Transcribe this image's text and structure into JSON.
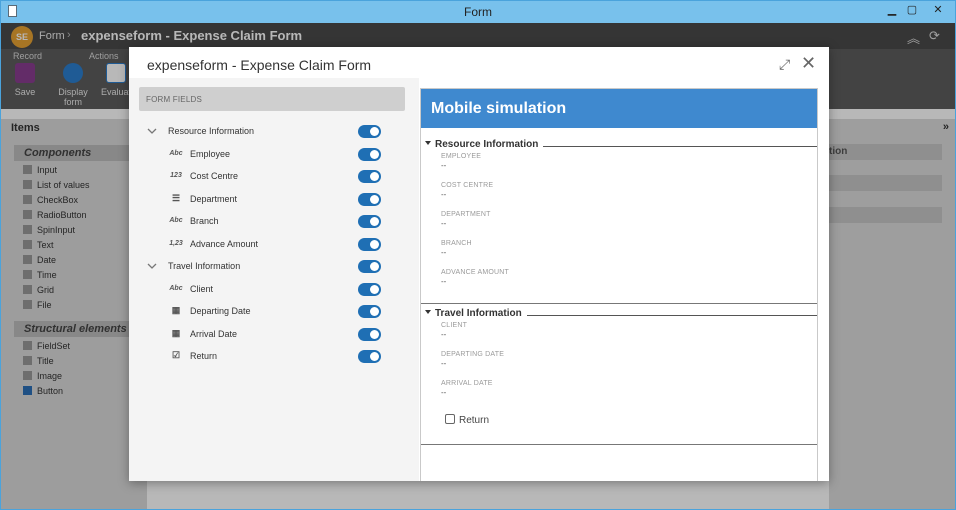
{
  "window": {
    "title": "Form"
  },
  "app": {
    "breadcrumb_root": "Form",
    "breadcrumb_current": "expenseform - Expense Claim Form"
  },
  "ribbon": {
    "group_record": "Record",
    "group_actions": "Actions",
    "save_label": "Save",
    "display_label": "Display form",
    "evaluate_label": "Evaluat"
  },
  "left_panel": {
    "title": "Items",
    "components_title": "Components",
    "components": [
      "Input",
      "List of values",
      "CheckBox",
      "RadioButton",
      "SpinInput",
      "Text",
      "Date",
      "Time",
      "Grid",
      "File"
    ],
    "structural_title": "Structural elements",
    "structural": [
      "FieldSet",
      "Title",
      "Image",
      "Button"
    ]
  },
  "right_panel": {
    "partial_text": "tion"
  },
  "modal": {
    "title": "expenseform - Expense Claim Form",
    "form_fields_header": "FORM FIELDS",
    "fields": [
      {
        "label": "Resource Information",
        "type": "group",
        "icon": "chevron-down-icon",
        "enabled": true
      },
      {
        "label": "Employee",
        "type": "child",
        "icon": "text-icon",
        "icon_text": "Abc",
        "enabled": true
      },
      {
        "label": "Cost Centre",
        "type": "child",
        "icon": "number-icon",
        "icon_text": "123",
        "enabled": true
      },
      {
        "label": "Department",
        "type": "child",
        "icon": "list-icon",
        "icon_text": "",
        "enabled": true
      },
      {
        "label": "Branch",
        "type": "child",
        "icon": "text-icon",
        "icon_text": "Abc",
        "enabled": true
      },
      {
        "label": "Advance Amount",
        "type": "child",
        "icon": "decimal-icon",
        "icon_text": "1,23",
        "enabled": true
      },
      {
        "label": "Travel Information",
        "type": "group",
        "icon": "chevron-down-icon",
        "enabled": true
      },
      {
        "label": "Client",
        "type": "child",
        "icon": "text-icon",
        "icon_text": "Abc",
        "enabled": true
      },
      {
        "label": "Departing Date",
        "type": "child",
        "icon": "calendar-icon",
        "icon_text": "",
        "enabled": true
      },
      {
        "label": "Arrival Date",
        "type": "child",
        "icon": "calendar-icon",
        "icon_text": "",
        "enabled": true
      },
      {
        "label": "Return",
        "type": "child",
        "icon": "checkbox-icon",
        "icon_text": "",
        "enabled": true
      }
    ],
    "mobile": {
      "title": "Mobile simulation",
      "sections": [
        {
          "title": "Resource Information",
          "fields": [
            {
              "label": "EMPLOYEE",
              "value": "--"
            },
            {
              "label": "COST CENTRE",
              "value": "--"
            },
            {
              "label": "DEPARTMENT",
              "value": "--"
            },
            {
              "label": "BRANCH",
              "value": "--"
            },
            {
              "label": "ADVANCE AMOUNT",
              "value": "--"
            }
          ]
        },
        {
          "title": "Travel Information",
          "fields": [
            {
              "label": "CLIENT",
              "value": "--"
            },
            {
              "label": "DEPARTING DATE",
              "value": "--"
            },
            {
              "label": "ARRIVAL DATE",
              "value": "--"
            }
          ],
          "checkbox": {
            "label": "Return",
            "checked": false
          }
        }
      ]
    }
  },
  "colors": {
    "toggle_on": "#1f6fb4",
    "mobile_header": "#3f89cf",
    "titlebar": "#78c1ec"
  }
}
